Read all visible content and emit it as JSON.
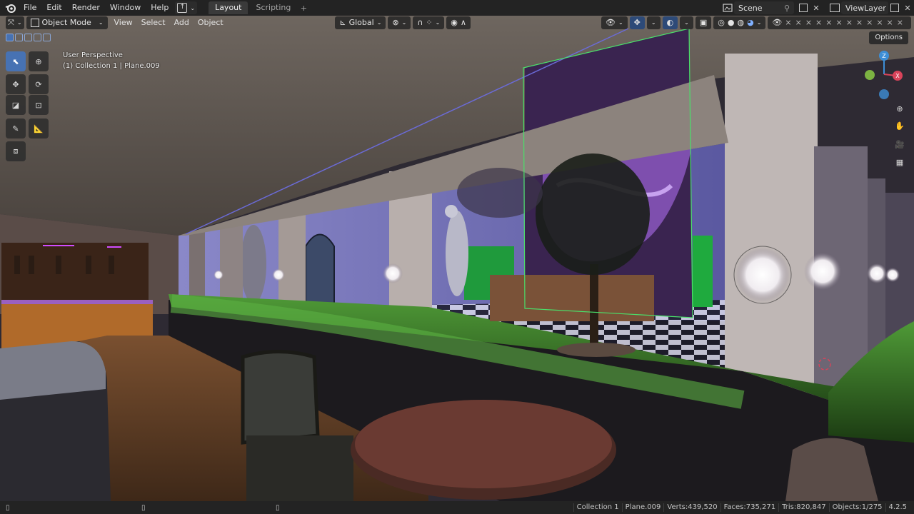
{
  "menu": [
    "File",
    "Edit",
    "Render",
    "Window",
    "Help"
  ],
  "workspace_tabs": [
    "Layout",
    "Scripting"
  ],
  "active_tab": "Layout",
  "scene_name": "Scene",
  "view_layer": "ViewLayer",
  "header": {
    "mode": "Object Mode",
    "menus": [
      "View",
      "Select",
      "Add",
      "Object"
    ],
    "orientation": "Global",
    "options": "Options"
  },
  "viewport_info": {
    "line1": "User Perspective",
    "line2": "(1) Collection 1 | Plane.009"
  },
  "gizmo_axes": {
    "x": "X",
    "y": "Y",
    "z": "Z"
  },
  "status": {
    "collection": "Collection 1",
    "object": "Plane.009",
    "verts": "Verts:439,520",
    "faces": "Faces:735,271",
    "tris": "Tris:820,847",
    "objects": "Objects:1/275",
    "version": "4.2.5"
  },
  "colors": {
    "accent": "#4772b3",
    "selection_outline": "#4ae06a",
    "x_axis": "#d9435a",
    "y_axis": "#7cb342",
    "z_axis": "#3d8ed6"
  },
  "icons": [
    "blender-logo",
    "select-box-icon",
    "cursor-icon",
    "move-icon",
    "rotate-icon",
    "scale-icon",
    "transform-icon",
    "annotate-icon",
    "measure-icon",
    "add-cube-icon",
    "zoom-icon",
    "hand-icon",
    "camera-icon",
    "grid-icon"
  ]
}
